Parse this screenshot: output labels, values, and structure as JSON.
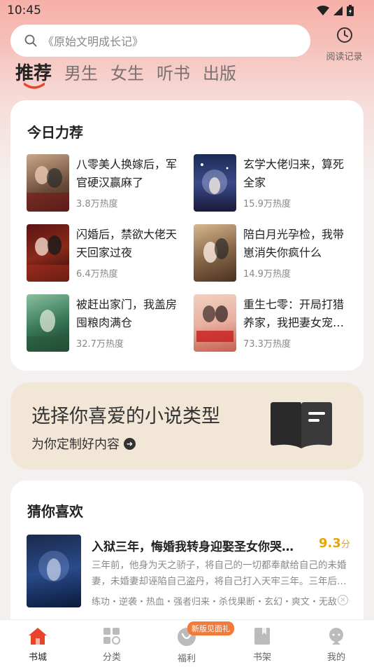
{
  "status_bar": {
    "time": "10:45"
  },
  "search": {
    "placeholder": "《原始文明成长记》"
  },
  "history": {
    "label": "阅读记录"
  },
  "tabs": [
    {
      "label": "推荐",
      "active": true
    },
    {
      "label": "男生"
    },
    {
      "label": "女生"
    },
    {
      "label": "听书"
    },
    {
      "label": "出版"
    }
  ],
  "today": {
    "title": "今日力荐",
    "items": [
      {
        "title": "八零美人换嫁后，军官硬汉赢麻了",
        "heat": "3.8万热度",
        "cover_text": "我的团长老公"
      },
      {
        "title": "玄学大佬归来，算死全家",
        "heat": "15.9万热度",
        "cover_text": "玄学大佬归来"
      },
      {
        "title": "闪婚后，禁欲大佬天天回家过夜",
        "heat": "6.4万热度",
        "cover_text": "禁欲大佬"
      },
      {
        "title": "陪白月光孕检，我带崽消失你疯什么",
        "heat": "14.9万热度",
        "cover_text": "我带崽消失"
      },
      {
        "title": "被赶出家门，我盖房囤粮肉满仓",
        "heat": "32.7万热度",
        "cover_text": "盖房囤粮"
      },
      {
        "title": "重生七零：开局打猎养家，我把妻女宠上天",
        "heat": "73.3万热度",
        "cover_text": "重生七零"
      }
    ]
  },
  "banner": {
    "title": "选择你喜爱的小说类型",
    "subtitle": "为你定制好内容"
  },
  "guess": {
    "title": "猜你喜欢",
    "book": {
      "title": "入狱三年，悔婚我转身迎娶圣女你哭什么",
      "score": "9.3",
      "score_unit": "分",
      "desc": "三年前，他身为天之骄子，将自己的一切都奉献给自己的未婚妻，未婚妻却诬陷自己盗丹，将自己打入天牢三年。三年后，他出狱归来",
      "tags": "练功・逆袭・热血・强者归来・杀伐果断・玄幻・爽文・无敌",
      "cover_text": "迎娶圣女"
    }
  },
  "bottom_nav": {
    "badge": "新版见面礼",
    "items": [
      {
        "label": "书城",
        "active": true
      },
      {
        "label": "分类"
      },
      {
        "label": "福利"
      },
      {
        "label": "书架"
      },
      {
        "label": "我的"
      }
    ]
  },
  "colors": {
    "accent": "#e8442a",
    "score": "#e8a400",
    "badge": "#f27a3a"
  }
}
